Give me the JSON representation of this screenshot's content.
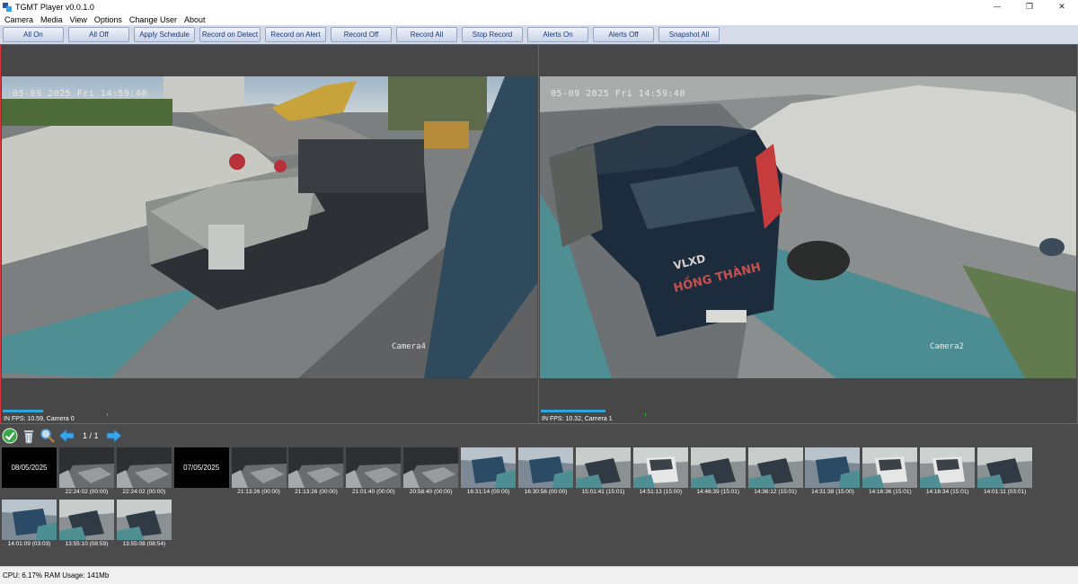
{
  "window": {
    "title": "TGMT Player v0.0.1.0",
    "controls": {
      "minimize": "—",
      "restore": "❐",
      "close": "✕"
    }
  },
  "menu": [
    "Camera",
    "Media",
    "View",
    "Options",
    "Change User",
    "About"
  ],
  "toolbar": {
    "buttons": [
      "All On",
      "All Off",
      "Apply Schedule",
      "Record on Detect",
      "Record on Alert",
      "Record Off",
      "Record All",
      "Stop Record",
      "Alerts On",
      "Alerts Off",
      "Snapshot All"
    ]
  },
  "cameras": [
    {
      "osd_time": "05-09 2025 Fri 14:59:40",
      "osd_label": "Camera4",
      "status": "IN  FPS: 10.59, Camera 0"
    },
    {
      "osd_time": "05-09 2025 Fri 14:59:40",
      "osd_label": "Camera2",
      "status": "IN  FPS: 10.32, Camera 1"
    }
  ],
  "recordings": {
    "page": "1 / 1",
    "icons": [
      "check-icon",
      "trash-icon",
      "search-icon",
      "arrow-left-icon",
      "arrow-right-icon"
    ],
    "items": [
      {
        "kind": "date",
        "label": "08/05/2025"
      },
      {
        "kind": "clip",
        "caption": "22:24:02 (00:00)",
        "scene": "night"
      },
      {
        "kind": "clip",
        "caption": "22:24:02 (00:00)",
        "scene": "night"
      },
      {
        "kind": "date",
        "label": "07/05/2025"
      },
      {
        "kind": "clip",
        "caption": "21:13:26 (00:00)",
        "scene": "night"
      },
      {
        "kind": "clip",
        "caption": "21:13:26 (00:00)",
        "scene": "night"
      },
      {
        "kind": "clip",
        "caption": "21:01:40 (00:00)",
        "scene": "night"
      },
      {
        "kind": "clip",
        "caption": "20:58:40 (00:00)",
        "scene": "night"
      },
      {
        "kind": "clip",
        "caption": "16:31:14 (00:00)",
        "scene": "day-blue"
      },
      {
        "kind": "clip",
        "caption": "16:30:56 (00:00)",
        "scene": "day-blue"
      },
      {
        "kind": "clip",
        "caption": "15:01:41 (15:01)",
        "scene": "day"
      },
      {
        "kind": "clip",
        "caption": "14:51:13 (15:00)",
        "scene": "day-white"
      },
      {
        "kind": "clip",
        "caption": "14:46:39 (15:01)",
        "scene": "day"
      },
      {
        "kind": "clip",
        "caption": "14:36:12 (15:01)",
        "scene": "day"
      },
      {
        "kind": "clip",
        "caption": "14:31:38 (15:00)",
        "scene": "day-blue"
      },
      {
        "kind": "clip",
        "caption": "14:16:36 (15:01)",
        "scene": "day-white"
      },
      {
        "kind": "clip",
        "caption": "14:16:34 (15:01)",
        "scene": "day-white"
      },
      {
        "kind": "clip",
        "caption": "14:01:11 (03:01)",
        "scene": "day"
      },
      {
        "kind": "clip",
        "caption": "14:01:09 (03:03)",
        "scene": "day-blue"
      },
      {
        "kind": "clip",
        "caption": "13:55:10 (08:59)",
        "scene": "day"
      },
      {
        "kind": "clip",
        "caption": "13:55:08 (08:54)",
        "scene": "day"
      }
    ]
  },
  "status": {
    "text": "CPU: 6.17% RAM Usage: 141Mb"
  },
  "colors": {
    "pane_border": "#d9363e",
    "toolbar_bg": "#d6dbe9",
    "accent_blue": "#2fa4d8"
  }
}
